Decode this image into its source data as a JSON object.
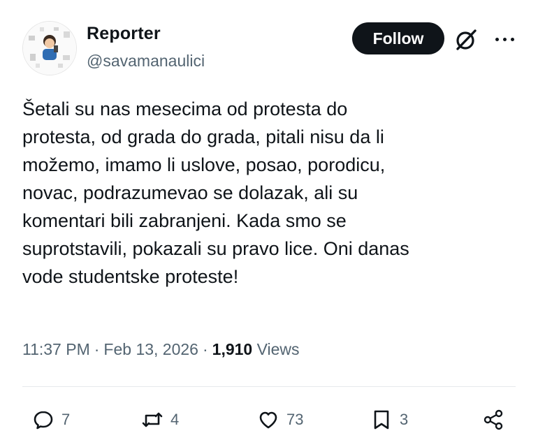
{
  "author": {
    "display_name": "Reporter",
    "handle": "@savamanaulici"
  },
  "header": {
    "follow_label": "Follow",
    "grok_icon": "grok-icon",
    "more_icon": "more-icon"
  },
  "tweet": {
    "text": "Šetali su nas mesecima od protesta do\nprotesta, od grada do grada, pitali nisu da li\nmožemo, imamo li uslove, posao, porodicu,\nnovac, podrazumevao se dolazak, ali su\nkomentari bili zabranjeni. Kada smo se\nsuprotstavili, pokazali su pravo lice. Oni danas\nvode studentske proteste!",
    "time": "11:37 PM",
    "date": "Feb 13, 2026",
    "separator": "·",
    "views_count": "1,910",
    "views_label": "Views"
  },
  "actions": {
    "replies": "7",
    "reposts": "4",
    "likes": "73",
    "bookmarks": "3"
  },
  "colors": {
    "text": "#0f1419",
    "secondary": "#536471",
    "button_bg": "#0f1419"
  }
}
